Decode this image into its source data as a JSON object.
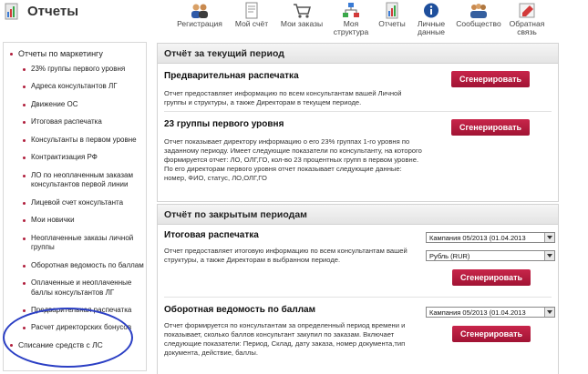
{
  "header": {
    "title": "Отчеты",
    "nav": [
      {
        "label": "Регистрация",
        "icon": "people-icon"
      },
      {
        "label": "Мой счёт",
        "icon": "document-icon"
      },
      {
        "label": "Мои заказы",
        "icon": "cart-icon"
      },
      {
        "label": "Моя структура",
        "icon": "structure-icon"
      },
      {
        "label": "Отчеты",
        "icon": "reports-icon"
      },
      {
        "label": "Личные данные",
        "icon": "info-icon"
      },
      {
        "label": "Сообщество",
        "icon": "community-icon"
      },
      {
        "label": "Обратная связь",
        "icon": "feedback-icon"
      }
    ]
  },
  "sidebar": {
    "top_item": "Отчеты по маркетингу",
    "items": [
      "23% группы первого уровня",
      "Адреса консультантов ЛГ",
      "Движение ОС",
      "Итоговая распечатка",
      "Консультанты в первом уровне",
      "Контрактизация РФ",
      "ЛО по неоплаченным заказам консультантов первой линии",
      "Лицевой счет консультанта",
      "Мои новички",
      "Неоплаченные заказы личной группы",
      "Оборотная ведомость по баллам",
      "Оплаченные и неоплаченные баллы консультантов ЛГ",
      "Предварительная распечатка",
      "Расчет директорских бонусов"
    ],
    "last_item": "Списание средств с ЛС"
  },
  "panel_current": {
    "header": "Отчёт за текущий период",
    "report1": {
      "title": "Предварительная распечатка",
      "desc": "Отчет предоставляет информацию по всем консультантам вашей Личной группы и структуры, а также Директорам в текущем периоде.",
      "button": "Сгенерировать"
    },
    "report2": {
      "title": "23 группы первого уровня",
      "desc": "Отчет показывает директору информацию о его 23% группах 1-го уровня по заданному периоду. Имеет следующие показатели по консультанту, на которого формируется отчет: ЛО, ОЛГ,ГО, кол-во 23 процентных групп в первом уровне. По его директорам первого уровня отчет показывает следующие данные: номер, ФИО, статус, ЛО,ОЛГ,ГО",
      "button": "Сгенерировать"
    }
  },
  "panel_closed": {
    "header": "Отчёт по закрытым периодам",
    "report1": {
      "title": "Итоговая распечатка",
      "desc": "Отчет предоставляет итоговую информацию по всем консультантам вашей структуры, а также Директорам в выбранном периоде.",
      "campaign": "Кампания 05/2013 (01.04.2013",
      "currency": "Рубль (RUR)",
      "button": "Сгенерировать"
    },
    "report2": {
      "title": "Оборотная ведомость по баллам",
      "desc": "Отчет формируется по консультантам за определенный период времени и показывает, сколько баллов консультант закупил по заказам. Включает следующие показатели: Период, Склад, дату заказа, номер документа,тип документа, действие, баллы.",
      "campaign": "Кампания 05/2013 (01.04.2013",
      "button": "Сгенерировать"
    }
  },
  "colors": {
    "accent": "#b01e3c",
    "circle": "#2b3fc4"
  }
}
